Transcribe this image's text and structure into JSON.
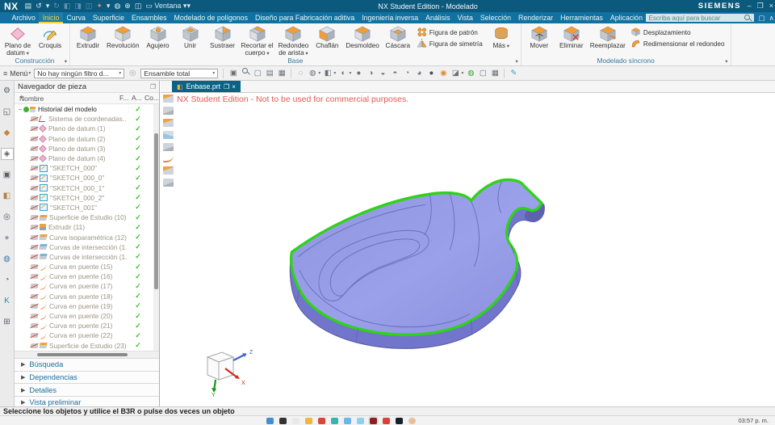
{
  "colors": {
    "titlebar": "#0b5a7d",
    "menubar": "#1171a1",
    "active_tab_yellow": "#f7cf3f",
    "tab_teal": "#0a6285",
    "ribbon_caption": "#35789f",
    "warning_red": "#e05a52",
    "check_green": "#35c425",
    "model_purple": "#8d91dd",
    "highlight_green": "#2fd318"
  },
  "titlebar": {
    "logo": "NX",
    "title": "NX Student Edition - Modelado",
    "brand": "SIEMENS",
    "window_menu": "Ventana",
    "qat": [
      {
        "name": "save-icon",
        "glyph": "▤"
      },
      {
        "name": "undo-icon",
        "glyph": "↺"
      },
      {
        "name": "undo-dropdown-icon",
        "glyph": "▾"
      },
      {
        "name": "redo-icon",
        "glyph": "↻",
        "dim": true
      },
      {
        "name": "cut-icon",
        "glyph": "◧",
        "dim": true
      },
      {
        "name": "copy-icon",
        "glyph": "◨",
        "dim": true
      },
      {
        "name": "paste-icon",
        "glyph": "◫",
        "dim": true
      },
      {
        "name": "brush-icon",
        "glyph": "✦",
        "color": "#e08a5a"
      },
      {
        "name": "brush-dropdown-icon",
        "glyph": "▾"
      },
      {
        "name": "microphone-icon",
        "glyph": "◍"
      },
      {
        "name": "touch-mode-icon",
        "glyph": "⊕"
      },
      {
        "name": "window-switch-icon",
        "glyph": "◫"
      }
    ],
    "window_buttons": [
      {
        "name": "minimize-button",
        "glyph": "–"
      },
      {
        "name": "restore-button",
        "glyph": "❐"
      },
      {
        "name": "close-button",
        "glyph": "×"
      }
    ]
  },
  "menubar": {
    "tabs": [
      {
        "label": "Archivo"
      },
      {
        "label": "Inicio",
        "active": true
      },
      {
        "label": "Curva"
      },
      {
        "label": "Superficie"
      },
      {
        "label": "Ensambles"
      },
      {
        "label": "Modelado de polígonos"
      },
      {
        "label": "Diseño para Fabricación aditiva"
      },
      {
        "label": "Ingeniería inversa"
      },
      {
        "label": "Análisis"
      },
      {
        "label": "Vista"
      },
      {
        "label": "Selección"
      },
      {
        "label": "Renderizar"
      },
      {
        "label": "Herramientas"
      },
      {
        "label": "Aplicación"
      }
    ],
    "search_placeholder": "Escriba aquí para buscar",
    "right_icons": [
      {
        "name": "fullscreen-icon",
        "glyph": "▢"
      },
      {
        "name": "minimize-ribbon-icon",
        "glyph": "∧"
      },
      {
        "name": "help-icon",
        "glyph": "?"
      }
    ]
  },
  "ribbon": {
    "groups": [
      {
        "label": "Construcción",
        "arrow": true,
        "items": [
          {
            "label": "Plano de\ndatum",
            "arrow": true,
            "icon": "datum-plane"
          },
          {
            "label": "Croquis",
            "icon": "sketch"
          }
        ]
      },
      {
        "label": "Base",
        "arrow": true,
        "items": [
          {
            "label": "Extrudir",
            "icon": "extrude"
          },
          {
            "label": "Revolución",
            "icon": "revolve"
          },
          {
            "label": "Agujero",
            "icon": "hole"
          },
          {
            "label": "Unir",
            "icon": "unite"
          },
          {
            "label": "Sustraer",
            "icon": "subtract"
          },
          {
            "label": "Recortar el\ncuerpo",
            "arrow": true,
            "icon": "trim"
          },
          {
            "label": "Redondeo\nde arista",
            "arrow": true,
            "icon": "blend"
          },
          {
            "label": "Chaflán",
            "icon": "chamfer"
          },
          {
            "label": "Desmoldeo",
            "icon": "draft"
          },
          {
            "label": "Cáscara",
            "icon": "shell"
          },
          {
            "stack": [
              {
                "label": "Figura de patrón",
                "icon": "pattern"
              },
              {
                "label": "Figura de simetría",
                "icon": "mirror"
              }
            ]
          },
          {
            "label": "Más",
            "arrow": true,
            "icon": "more"
          }
        ]
      },
      {
        "label": "Modelado síncrono",
        "arrow": true,
        "items": [
          {
            "label": "Mover",
            "icon": "move"
          },
          {
            "label": "Eliminar",
            "icon": "delete"
          },
          {
            "label": "Reemplazar",
            "icon": "replace"
          },
          {
            "stack": [
              {
                "label": "Desplazamiento",
                "icon": "offset"
              },
              {
                "label": "Redimensionar el redondeo",
                "icon": "resize"
              }
            ]
          }
        ]
      }
    ]
  },
  "toolbar2": {
    "menu_label": "Menú",
    "filter_value": "No hay ningún filtro d...",
    "scope_value": "Ensamble total",
    "icons": [
      {
        "name": "window-layout-icon",
        "glyph": "▣"
      },
      {
        "name": "find-feature-icon",
        "glyph": "mag"
      },
      {
        "name": "dialog-box-icon",
        "glyph": "▢"
      },
      {
        "name": "information-window-icon",
        "glyph": "▤"
      },
      {
        "name": "touch-panel-icon",
        "glyph": "▦"
      },
      {
        "sep": true
      },
      {
        "name": "wireframe-display-icon",
        "glyph": "◌"
      },
      {
        "name": "shaded-with-edges-icon",
        "glyph": "◍",
        "dd": true
      },
      {
        "name": "orient-view-icon",
        "glyph": "◧",
        "dd": true
      },
      {
        "name": "shaded-view-icon",
        "glyph": "◐",
        "dd": true
      },
      {
        "name": "display-sphere-1-icon",
        "glyph": "●"
      },
      {
        "name": "display-sphere-2-icon",
        "glyph": "◑"
      },
      {
        "name": "display-sphere-3-icon",
        "glyph": "◒"
      },
      {
        "name": "display-sphere-4-icon",
        "glyph": "◓"
      },
      {
        "name": "display-sphere-5-icon",
        "glyph": "◔"
      },
      {
        "name": "display-sphere-6-icon",
        "glyph": "◕"
      },
      {
        "name": "dark-sphere-icon",
        "glyph": "●",
        "color": "#4e4e55"
      },
      {
        "name": "render-style-icon",
        "glyph": "◉",
        "color": "#e08830"
      },
      {
        "name": "assign-material-icon",
        "glyph": "◪",
        "dd": true
      },
      {
        "name": "true-shading-icon",
        "glyph": "◍",
        "color": "#3aa335"
      },
      {
        "name": "section-view-icon",
        "glyph": "▢"
      },
      {
        "name": "grid-icon",
        "glyph": "▦"
      },
      {
        "sep": true
      },
      {
        "name": "sketch-pencil-icon",
        "glyph": "✎",
        "color": "#3e9bbf"
      }
    ]
  },
  "tabstrip": {
    "active_tab": "Enbase.prt",
    "tab_buttons": [
      {
        "name": "tab-float-icon",
        "glyph": "❐"
      },
      {
        "name": "tab-close-icon",
        "glyph": "×"
      }
    ]
  },
  "canvas": {
    "watermark": "NX Student Edition - Not to be used for commercial purposes.",
    "triad": {
      "x": "X",
      "y": "Y",
      "z": "Z"
    },
    "side_tools": [
      {
        "name": "studio-surface-icon",
        "variant": "a"
      },
      {
        "name": "through-curves-icon",
        "variant": "b"
      },
      {
        "name": "swept-surface-icon",
        "variant": "a"
      },
      {
        "name": "mesh-surface-icon",
        "variant": "c"
      },
      {
        "name": "offset-surface-icon",
        "variant": "b"
      },
      {
        "name": "bridge-curve-icon",
        "variant": "d"
      },
      {
        "name": "fill-surface-icon",
        "variant": "a"
      },
      {
        "name": "sheet-body-icon",
        "variant": "b"
      }
    ]
  },
  "resource_bar": {
    "icons": [
      {
        "name": "roles-gear-icon",
        "glyph": "⚙"
      },
      {
        "name": "assembly-navigator-icon",
        "glyph": "◱"
      },
      {
        "name": "constraint-navigator-icon",
        "glyph": "◆",
        "color": "#c78440"
      },
      {
        "name": "part-navigator-icon",
        "glyph": "◈",
        "active": true
      },
      {
        "name": "reuse-library-icon",
        "glyph": "▣"
      },
      {
        "name": "view-manager-icon",
        "glyph": "◧",
        "color": "#b08040"
      },
      {
        "name": "hd3d-tools-icon",
        "glyph": "◎"
      },
      {
        "name": "rounds-icon",
        "glyph": "●",
        "color": "#9a9fa6"
      },
      {
        "name": "web-browser-icon",
        "glyph": "◍",
        "color": "#3a78b5"
      },
      {
        "name": "history-icon",
        "glyph": "◔"
      },
      {
        "name": "knowledge-fusion-icon",
        "glyph": "K",
        "color": "#2a8fa8"
      },
      {
        "name": "machining-wizard-icon",
        "glyph": "⊞"
      }
    ]
  },
  "navigator": {
    "title": "Navegador de pieza",
    "columns": [
      "Nombre",
      "F...",
      "A...",
      "Co..."
    ],
    "rows": [
      {
        "label": "Historial del modelo",
        "icon": "history",
        "root": true,
        "check": true
      },
      {
        "label": "Sistema de coordenadas...",
        "icon": "csys",
        "check": true
      },
      {
        "label": "Plano de datum (1)",
        "icon": "datum",
        "check": true
      },
      {
        "label": "Plano de datum (2)",
        "icon": "datum",
        "check": true
      },
      {
        "label": "Plano de datum (3)",
        "icon": "datum",
        "check": true
      },
      {
        "label": "Plano de datum (4)",
        "icon": "datum",
        "check": true
      },
      {
        "label": "\"SKETCH_000\"",
        "icon": "sketch",
        "check": true
      },
      {
        "label": "\"SKETCH_000_0\"",
        "icon": "sketch",
        "check": true
      },
      {
        "label": "\"SKETCH_000_1\"",
        "icon": "sketch",
        "check": true
      },
      {
        "label": "\"SKETCH_000_2\"",
        "icon": "sketch",
        "check": true
      },
      {
        "label": "\"SKETCH_001\"",
        "icon": "sketch",
        "check": true
      },
      {
        "label": "Superficie de Estudio (10)",
        "icon": "surface",
        "check": true
      },
      {
        "label": "Extrudir (11)",
        "icon": "extrude",
        "check": true
      },
      {
        "label": "Curva isoparamétrica (12)",
        "icon": "surface",
        "check": true
      },
      {
        "label": "Curvas de intersección (1...",
        "icon": "intersect",
        "check": true
      },
      {
        "label": "Curvas de intersección (1...",
        "icon": "intersect",
        "check": true
      },
      {
        "label": "Curva en puente (15)",
        "icon": "curve",
        "check": true
      },
      {
        "label": "Curva en puente (16)",
        "icon": "curve",
        "check": true
      },
      {
        "label": "Curva en puente (17)",
        "icon": "curve",
        "check": true
      },
      {
        "label": "Curva en puente (18)",
        "icon": "curve",
        "check": true
      },
      {
        "label": "Curva en puente (19)",
        "icon": "curve",
        "check": true
      },
      {
        "label": "Curva en puente (20)",
        "icon": "curve",
        "check": true
      },
      {
        "label": "Curva en puente (21)",
        "icon": "curve",
        "check": true
      },
      {
        "label": "Curva en puente (22)",
        "icon": "curve",
        "check": true
      },
      {
        "label": "Superficie de Estudio (23)",
        "icon": "surface",
        "check": true
      }
    ],
    "sections": [
      "Búsqueda",
      "Dependencias",
      "Detalles",
      "Vista preliminar"
    ]
  },
  "statusbar": {
    "message": "Seleccione los objetos y utilice el B3R o pulse dos veces un objeto"
  },
  "taskbar": {
    "clock": "03:57 p. m.",
    "apps": [
      {
        "name": "taskbar-app-blue",
        "color": "#3f8fd4"
      },
      {
        "name": "taskbar-app-black",
        "color": "#333333"
      },
      {
        "name": "taskbar-app-white",
        "color": "#e9e9e9"
      },
      {
        "name": "taskbar-app-yellow",
        "color": "#f2b63c"
      },
      {
        "name": "taskbar-app-red",
        "color": "#d8453a"
      },
      {
        "name": "taskbar-app-teal",
        "color": "#35b5ad"
      },
      {
        "name": "taskbar-app-lightblue",
        "color": "#68b8e8"
      },
      {
        "name": "taskbar-app-sky",
        "color": "#8fd0f0"
      },
      {
        "name": "taskbar-app-nx",
        "color": "#8a2020",
        "hl": true
      },
      {
        "name": "taskbar-app-red2",
        "color": "#e04034"
      },
      {
        "name": "taskbar-app-dark",
        "color": "#15202b"
      },
      {
        "name": "taskbar-app-avatar",
        "color": "#e8bf96"
      }
    ]
  }
}
